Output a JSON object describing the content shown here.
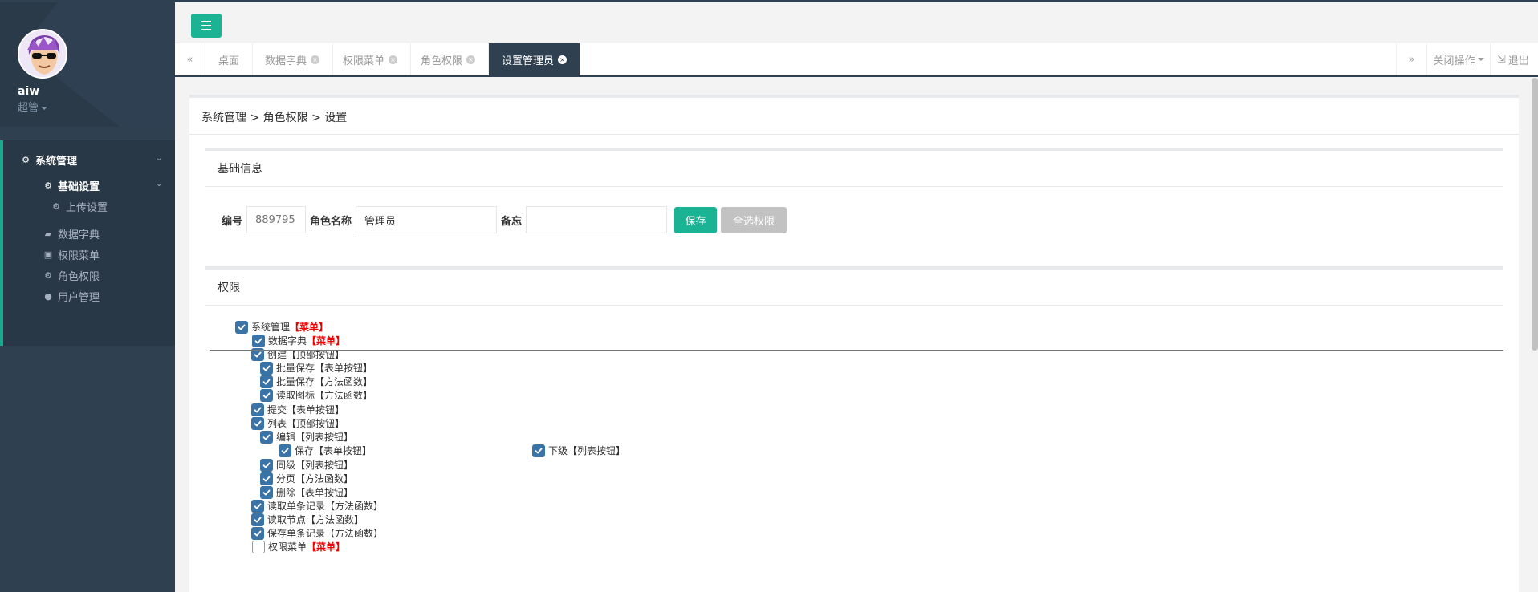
{
  "user": {
    "name": "aiw",
    "role": "超管"
  },
  "sidebar": {
    "items": [
      {
        "label": "系统管理",
        "icon": "gear-icon"
      },
      {
        "label": "基础设置",
        "icon": "gear-icon"
      },
      {
        "label": "上传设置",
        "icon": "gear-icon"
      },
      {
        "label": "数据字典",
        "icon": "book-icon"
      },
      {
        "label": "权限菜单",
        "icon": "save-icon"
      },
      {
        "label": "角色权限",
        "icon": "gear-icon"
      },
      {
        "label": "用户管理",
        "icon": "users-icon"
      }
    ]
  },
  "tabs": {
    "left_arrow": "«",
    "right_arrow": "»",
    "items": [
      {
        "label": "桌面"
      },
      {
        "label": "数据字典"
      },
      {
        "label": "权限菜单"
      },
      {
        "label": "角色权限"
      },
      {
        "label": "设置管理员"
      }
    ],
    "close_ops": "关闭操作",
    "logout": "退出"
  },
  "breadcrumb": "系统管理 > 角色权限 > 设置",
  "basic": {
    "title": "基础信息",
    "id_label": "编号",
    "id_value": "889795",
    "name_label": "角色名称",
    "name_value": "管理员",
    "remark_label": "备忘",
    "remark_value": "",
    "save_label": "保存",
    "select_all_label": "全选权限"
  },
  "permissions": {
    "title": "权限",
    "tree": [
      {
        "label": "系统管理",
        "kind": "【菜单】"
      },
      {
        "label": "数据字典",
        "kind": "【菜单】"
      },
      {
        "label": "创建",
        "kind": "【顶部按钮】"
      },
      {
        "label": "批量保存",
        "kind": "【表单按钮】"
      },
      {
        "label": "批量保存",
        "kind": "【方法函数】"
      },
      {
        "label": "读取图标",
        "kind": "【方法函数】"
      },
      {
        "label": "提交",
        "kind": "【表单按钮】"
      },
      {
        "label": "列表",
        "kind": "【顶部按钮】"
      },
      {
        "label": "编辑",
        "kind": "【列表按钮】"
      },
      {
        "label": "保存",
        "kind": "【表单按钮】"
      },
      {
        "label": "下级",
        "kind": "【列表按钮】"
      },
      {
        "label": "同级",
        "kind": "【列表按钮】"
      },
      {
        "label": "分页",
        "kind": "【方法函数】"
      },
      {
        "label": "删除",
        "kind": "【表单按钮】"
      },
      {
        "label": "读取单条记录",
        "kind": "【方法函数】"
      },
      {
        "label": "读取节点",
        "kind": "【方法函数】"
      },
      {
        "label": "保存单条记录",
        "kind": "【方法函数】"
      },
      {
        "label": "权限菜单",
        "kind": "【菜单】"
      }
    ]
  },
  "colors": {
    "accent": "#1ab394",
    "sidebar": "#2f4050",
    "checkbox": "#3a73a6",
    "menu_tag": "#ee0000"
  }
}
